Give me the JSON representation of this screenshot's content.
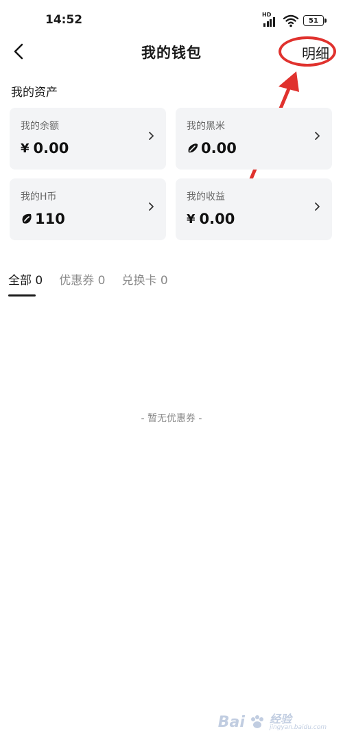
{
  "status_bar": {
    "time": "14:52",
    "network_label": "HD",
    "battery": "51",
    "icons": [
      "signal-icon",
      "wifi-icon",
      "battery-icon"
    ]
  },
  "header": {
    "title": "我的钱包",
    "detail_link": "明细",
    "back_icon": "back-arrow-icon"
  },
  "assets": {
    "section_title": "我的资产",
    "cards": [
      {
        "label": "我的余额",
        "prefix": "¥",
        "value": "0.00",
        "icon": null
      },
      {
        "label": "我的黑米",
        "prefix": "",
        "value": "0.00",
        "icon": "heimi-coin-icon"
      },
      {
        "label": "我的H币",
        "prefix": "",
        "value": "110",
        "icon": "h-coin-icon"
      },
      {
        "label": "我的收益",
        "prefix": "¥",
        "value": "0.00",
        "icon": null
      }
    ]
  },
  "tabs": [
    {
      "label": "全部",
      "count": "0",
      "active": true
    },
    {
      "label": "优惠券",
      "count": "0",
      "active": false
    },
    {
      "label": "兑换卡",
      "count": "0",
      "active": false
    }
  ],
  "empty_state": "- 暂无优惠券 -",
  "watermark": {
    "brand": "Bai",
    "suffix": "经验",
    "site": "jingyan.baidu.com"
  },
  "colors": {
    "annotation_red": "#e0322e",
    "card_background": "#f3f4f6",
    "inactive_tab": "#8a8a8a"
  }
}
